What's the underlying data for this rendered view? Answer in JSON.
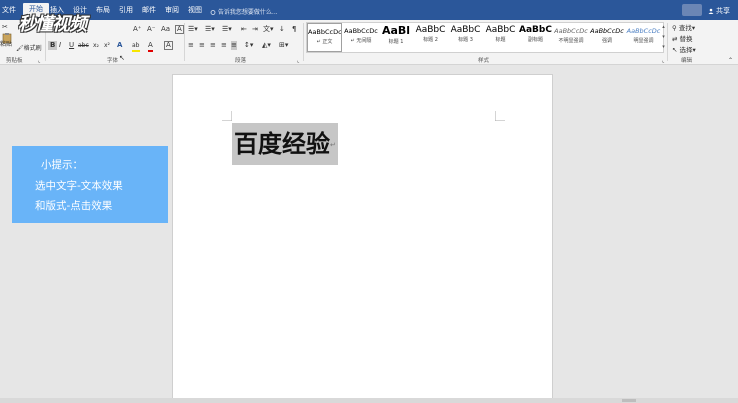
{
  "window": {
    "title_bar_color": "#2b579a",
    "tabs": [
      "文件",
      "开始",
      "插入",
      "设计",
      "布局",
      "引用",
      "邮件",
      "审阅",
      "视图"
    ],
    "active_tab": "开始",
    "tell_me": "告诉我您想要做什么...",
    "share": "共享"
  },
  "logo": {
    "text": "秒懂视频"
  },
  "ribbon": {
    "clipboard": {
      "paste": "粘贴",
      "format_painter": "格式刷",
      "label": "剪贴板"
    },
    "font": {
      "label": "字体",
      "grow": "A⁺",
      "shrink": "A⁻",
      "clear": "Aa",
      "bold": "B",
      "italic": "I",
      "underline": "U",
      "strike": "abc",
      "sub": "x₂",
      "sup": "x²",
      "effects": "A",
      "highlight": "ab",
      "font_color": "A"
    },
    "paragraph": {
      "label": "段落"
    },
    "styles": {
      "label": "样式",
      "items": [
        {
          "preview": "AaBbCcDc",
          "name": "↵ 正文"
        },
        {
          "preview": "AaBbCcDc",
          "name": "↵ 无间隔"
        },
        {
          "preview": "AaBl",
          "name": "标题 1"
        },
        {
          "preview": "AaBbC",
          "name": "标题 2"
        },
        {
          "preview": "AaBbC",
          "name": "标题 3"
        },
        {
          "preview": "AaBbC",
          "name": "标题"
        },
        {
          "preview": "AaBbC",
          "name": "副标题"
        },
        {
          "preview": "AaBbCcDc",
          "name": "不明显强调"
        },
        {
          "preview": "AaBbCcDc",
          "name": "强调"
        },
        {
          "preview": "AaBbCcDc",
          "name": "明显强调"
        }
      ]
    },
    "editing": {
      "label": "编辑",
      "find": "查找",
      "replace": "替换",
      "select": "选择"
    }
  },
  "document": {
    "text": "百度经验",
    "para_mark": "↵"
  },
  "tip": {
    "line1": "小提示：",
    "line2": "选中文字-文本效果",
    "line3": "和版式-点击效果",
    "color": "#69b4f8"
  }
}
